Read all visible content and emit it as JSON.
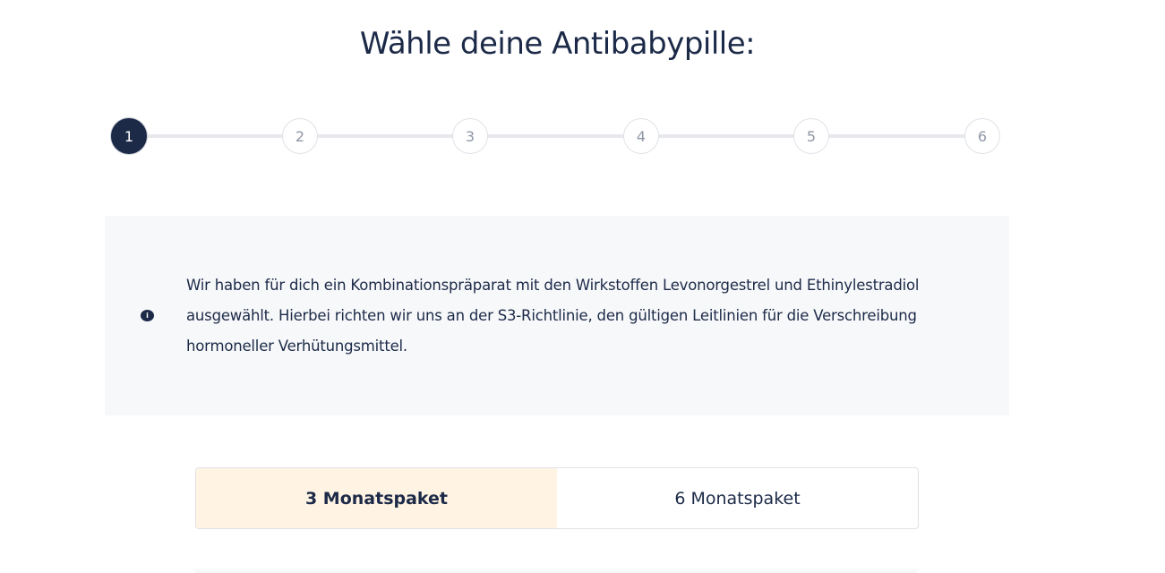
{
  "header": {
    "title": "Wähle deine Antibabypille:"
  },
  "stepper": {
    "steps": [
      "1",
      "2",
      "3",
      "4",
      "5",
      "6"
    ],
    "active_step": 1
  },
  "info": {
    "icon": "info-icon",
    "icon_glyph": "i",
    "text": "Wir haben für dich ein Kombinationspräparat mit den Wirkstoffen Levonorgestrel und Ethinylestradiol ausgewählt. Hierbei richten wir uns an der S3-Richtlinie, den gültigen Leitlinien für die Verschreibung hormoneller Verhütungsmittel."
  },
  "packages": {
    "options": [
      "3 Monatspaket",
      "6 Monatspaket"
    ],
    "selected": "3 Monatspaket"
  },
  "colors": {
    "primary": "#1c2a48",
    "selected_bg": "#fff4e3",
    "info_bg": "#f7f8fa"
  }
}
